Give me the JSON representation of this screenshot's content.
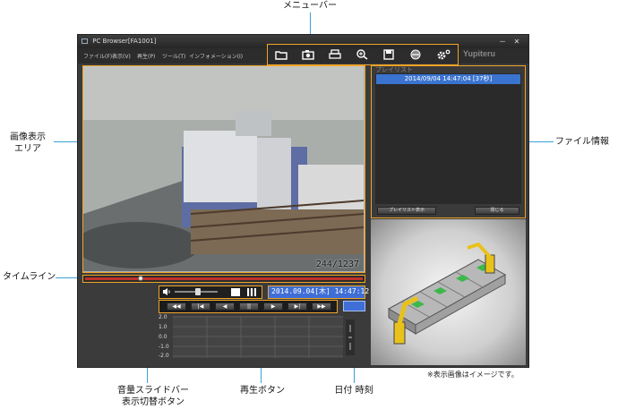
{
  "annotations": {
    "menubar": "メニューバー",
    "image_area_line1": "画像表示",
    "image_area_line2": "エリア",
    "timeline": "タイムライン",
    "file_info": "ファイル情報",
    "volume_line1": "音量スライドバー",
    "volume_line2": "表示切替ボタン",
    "playback": "再生ボタン",
    "datetime": "日付 時刻",
    "note": "※表示画像はイメージです。"
  },
  "window": {
    "title": "PC Browser[FA1001]",
    "controls": {
      "minimize": "－",
      "close": "✕"
    },
    "brand": "Yupiteru"
  },
  "menu": [
    "ファイル(F)",
    "表示(V)",
    "再生(P)",
    "ツール(T)",
    "インフォメーション(I)"
  ],
  "toolbar_icons": [
    "folder-icon",
    "camera-icon",
    "print-icon",
    "zoom-icon",
    "save-icon",
    "disc-icon",
    "settings-icon"
  ],
  "video": {
    "frame_counter": "244/1237",
    "playback_fraction": 0.2
  },
  "volume": {
    "level_fraction": 0.55
  },
  "datetime": "2014.09.04[木] 14:47:12",
  "playback_buttons": [
    "◀◀",
    "|◀",
    "◀",
    "||",
    "▶",
    "▶|",
    "▶▶"
  ],
  "graph": {
    "y_labels": [
      "2.0",
      "1.0",
      "0.0",
      "-1.0",
      "-2.0"
    ]
  },
  "file_panel": {
    "header": "プレイリスト",
    "entries": [
      "2014/09/04 14:47:04 [37秒]"
    ],
    "button_left": "プレイリスト表示",
    "button_right": "閉じる"
  }
}
